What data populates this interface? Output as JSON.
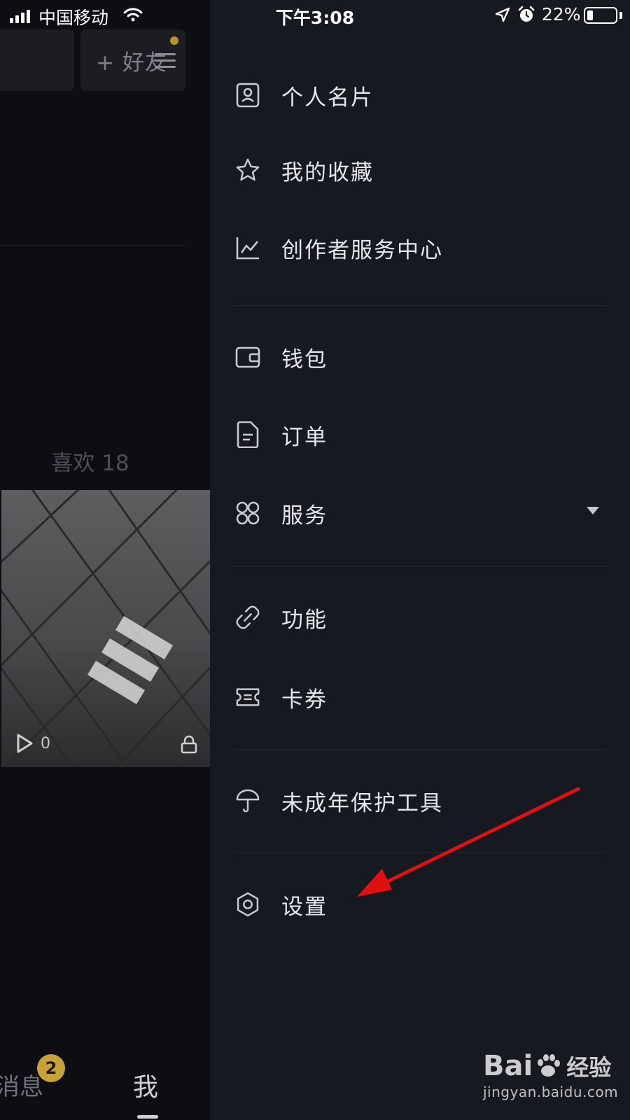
{
  "status_bar": {
    "carrier": "中国移动",
    "time": "下午3:08",
    "battery_percent": "22%",
    "battery_level": 0.22
  },
  "background_app": {
    "add_friend_label": "+ 好友",
    "likes_label": "喜欢 18",
    "video_play_count": "0",
    "tabs": {
      "messages_label": "消息",
      "messages_badge": "2",
      "me_label": "我"
    }
  },
  "drawer": {
    "items": [
      {
        "label": "个人名片",
        "icon": "profile-card-icon"
      },
      {
        "label": "我的收藏",
        "icon": "star-icon"
      },
      {
        "label": "创作者服务中心",
        "icon": "chart-line-icon"
      },
      {
        "label": "钱包",
        "icon": "wallet-icon"
      },
      {
        "label": "订单",
        "icon": "document-icon"
      },
      {
        "label": "服务",
        "icon": "grid-four-icon"
      },
      {
        "label": "功能",
        "icon": "link-icon"
      },
      {
        "label": "卡券",
        "icon": "ticket-icon"
      },
      {
        "label": "未成年保护工具",
        "icon": "umbrella-icon"
      },
      {
        "label": "设置",
        "icon": "gear-icon"
      }
    ]
  },
  "watermark": {
    "brand": "Bai",
    "brand_suffix": "经验",
    "url": "jingyan.baidu.com"
  },
  "colors": {
    "drawer_bg": "#171920",
    "annotation_arrow": "#e01010",
    "badge": "#c9a13a"
  }
}
